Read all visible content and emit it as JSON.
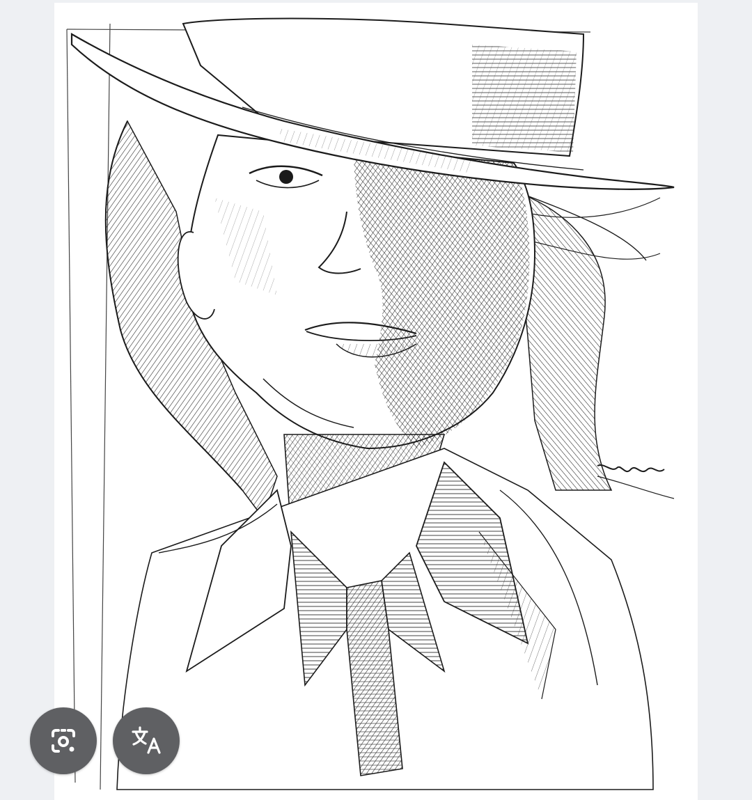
{
  "image": {
    "subject": "pen-and-ink crosshatched portrait sketch",
    "signature": "masa"
  },
  "actions": {
    "lens_button": {
      "icon": "lens-camera-icon",
      "label": "Search image"
    },
    "translate_button": {
      "icon": "translate-icon",
      "label": "Translate"
    }
  },
  "colors": {
    "background": "#eef0f3",
    "image_background": "#ffffff",
    "button_fill": "#5f6063",
    "icon_color": "#ffffff",
    "ink": "#1b1b1b"
  }
}
